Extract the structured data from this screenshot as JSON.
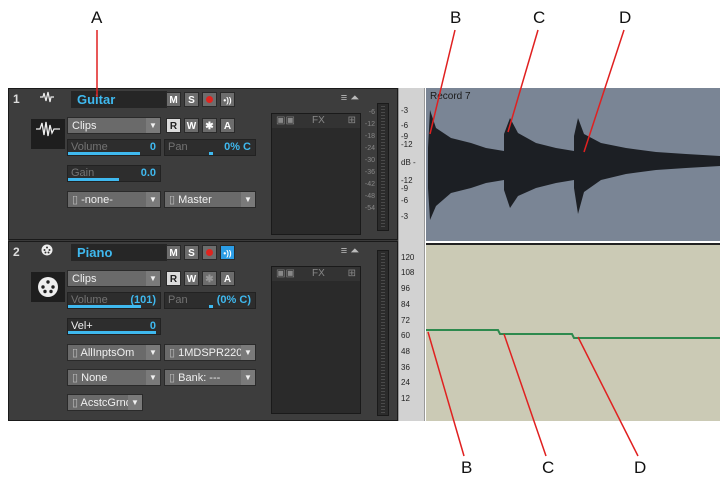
{
  "callouts": {
    "top": [
      "A",
      "B",
      "C",
      "D"
    ],
    "bottom": [
      "B",
      "C",
      "D"
    ],
    "line_color": "#e02020"
  },
  "tracks": [
    {
      "number": "1",
      "name": "Guitar",
      "type_icon": "audio-waveform-icon",
      "buttons": [
        "M",
        "S",
        "R",
        "W",
        "*",
        "A"
      ],
      "input_mode": "Clips",
      "volume_label": "Volume",
      "volume_value": "0",
      "volume_fraction": 0.78,
      "pan_label": "Pan",
      "pan_value": "0% C",
      "param3_label": "Gain",
      "param3_value": "0.0",
      "input": "-none-",
      "output": "Master",
      "fx_label": "FX",
      "meter_scale": [
        "-6",
        "-12",
        "-18",
        "-24",
        "-30",
        "-36",
        "-42",
        "-48",
        "-54"
      ]
    },
    {
      "number": "2",
      "name": "Piano",
      "type_icon": "midi-plug-icon",
      "buttons": [
        "M",
        "S",
        "R",
        "W",
        "*",
        "A"
      ],
      "input_mode": "Clips",
      "volume_label": "Volume",
      "volume_value": "(101)",
      "volume_fraction": 0.79,
      "pan_label": "Pan",
      "pan_value": "(0% C)",
      "param3_label": "Vel+",
      "param3_value": "0",
      "input": "AllInptsOm",
      "output": "1MDSPR220",
      "channel": "None",
      "bank": "Bank: ---",
      "patch": "AcstcGrndP",
      "fx_label": "FX"
    }
  ],
  "audio_clip": {
    "title": "Record 7",
    "ruler": [
      "-3",
      "-6",
      "-9",
      "-12",
      "dB -",
      "-12",
      "-9",
      "-6",
      "-3"
    ]
  },
  "midi_clip": {
    "ruler": [
      "120",
      "108",
      "96",
      "84",
      "72",
      "60",
      "48",
      "36",
      "24",
      "12"
    ],
    "curve_color": "#2e8a4e"
  }
}
